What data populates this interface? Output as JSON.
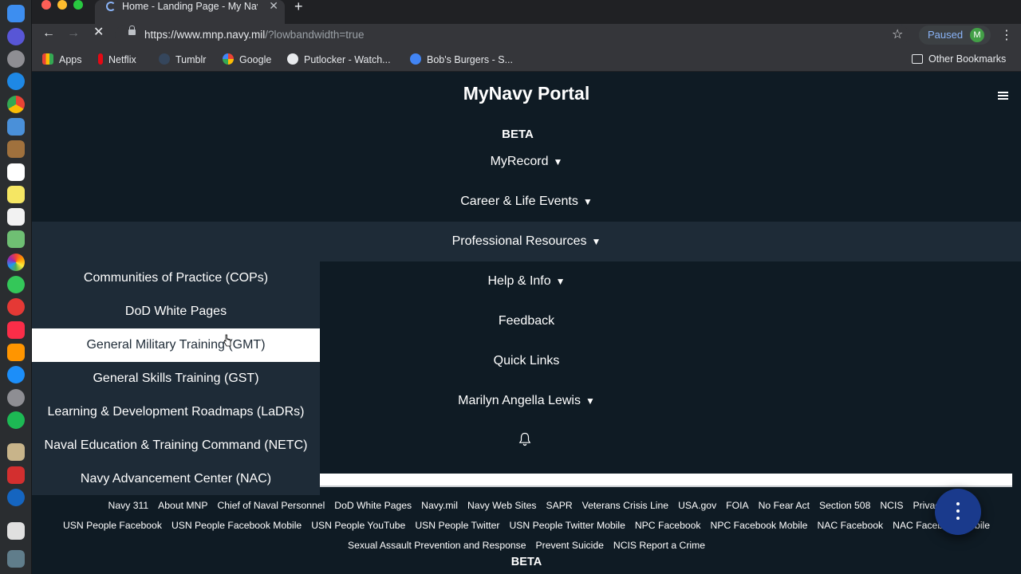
{
  "browser": {
    "tab_title": "Home - Landing Page - My Nav",
    "tab_close": "✕",
    "new_tab": "+",
    "url_main": "https://www.mnp.navy.mil",
    "url_rest": "/?lowbandwidth=true",
    "profile_status": "Paused",
    "profile_initial": "M",
    "bookmarks": [
      {
        "label": "Apps",
        "icon": "apps-grid-icon",
        "color": "#ea4335"
      },
      {
        "label": "Netflix",
        "icon": "netflix-icon",
        "color": "#e50914"
      },
      {
        "label": "Tumblr",
        "icon": "tumblr-icon",
        "color": "#35465c"
      },
      {
        "label": "Google",
        "icon": "google-icon",
        "color": "#ffffff"
      },
      {
        "label": "Putlocker - Watch...",
        "icon": "globe-icon",
        "color": "#9aa0a6"
      },
      {
        "label": "Bob's Burgers - S...",
        "icon": "play-circle-icon",
        "color": "#4285f4"
      }
    ],
    "other_bookmarks": "Other Bookmarks"
  },
  "page": {
    "brand": "MyNavy Portal",
    "beta_top": "BETA",
    "menu": [
      {
        "label": "MyRecord",
        "caret": "▼"
      },
      {
        "label": "Career & Life Events",
        "caret": "▼"
      },
      {
        "label": "Professional Resources",
        "caret": "▼"
      },
      {
        "label": "Help & Info",
        "caret": "▼"
      },
      {
        "label": "Feedback",
        "caret": ""
      },
      {
        "label": "Quick Links",
        "caret": ""
      },
      {
        "label": "Marilyn Angella Lewis",
        "caret": "▼"
      }
    ],
    "dropdown": [
      "Communities of Practice (COPs)",
      "DoD White Pages",
      "General Military Training (GMT)",
      "General Skills Training (GST)",
      "Learning & Development Roadmaps (LaDRs)",
      "Naval Education & Training Command (NETC)",
      "Navy Advancement Center (NAC)"
    ],
    "footer_row1": [
      "Navy 311",
      "About MNP",
      "Chief of Naval Personnel",
      "DoD White Pages",
      "Navy.mil",
      "Navy Web Sites",
      "SAPR",
      "Veterans Crisis Line",
      "USA.gov",
      "FOIA",
      "No Fear Act",
      "Section 508",
      "NCIS",
      "Privacy"
    ],
    "footer_row2": [
      "USN People Facebook",
      "USN People Facebook Mobile",
      "USN People YouTube",
      "USN People Twitter",
      "USN People Twitter Mobile",
      "NPC Facebook",
      "NPC Facebook Mobile",
      "NAC Facebook",
      "NAC Facebook Mobile"
    ],
    "footer_row3": [
      "Sexual Assault Prevention and Response",
      "Prevent Suicide",
      "NCIS Report a Crime"
    ],
    "beta_bottom": "BETA"
  },
  "colors": {
    "page_bg": "#0f1b24",
    "menu_active_bg": "#1e2b37",
    "fab": "#1a3a8c"
  }
}
